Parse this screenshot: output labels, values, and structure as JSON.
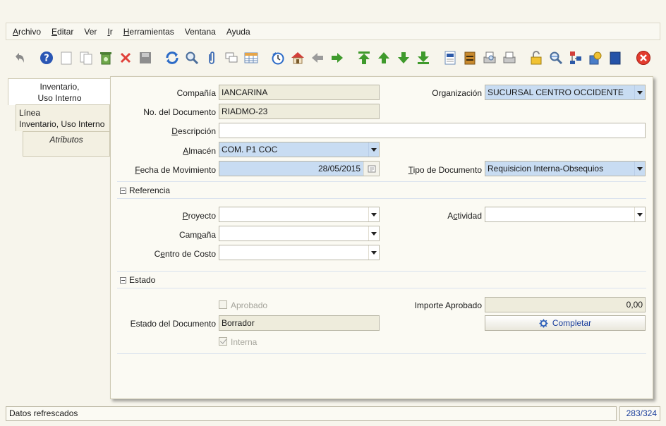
{
  "menu": {
    "archivo": {
      "first": "A",
      "rest": "rchivo"
    },
    "editar": {
      "first": "E",
      "rest": "ditar"
    },
    "ver": {
      "first": "",
      "rest": "Ver"
    },
    "ir": {
      "first": "I",
      "rest": "r"
    },
    "herramientas": {
      "first": "H",
      "rest": "erramientas"
    },
    "ventana": {
      "first": "",
      "rest": "Ventana"
    },
    "ayuda": {
      "first": "",
      "rest": "Ayuda"
    }
  },
  "tabs": {
    "t1_line1": "Inventario,",
    "t1_line2": "Uso Interno",
    "t2_line1": "Línea",
    "t2_line2": "Inventario, Uso Interno",
    "t3": "Atributos"
  },
  "form": {
    "compania_label": "Compañía",
    "compania_value": "IANCARINA",
    "organizacion_label": "Organización",
    "organizacion_value": "SUCURSAL CENTRO OCCIDENTE",
    "nodoc_label": "No. del Documento",
    "nodoc_value": "RIADMO-23",
    "descripcion_label": {
      "first": "D",
      "rest": "escripción"
    },
    "descripcion_value": "",
    "almacen_label": {
      "first": "A",
      "rest": "lmacén"
    },
    "almacen_value": "COM. P1 COC",
    "fecha_label": {
      "first": "F",
      "rest": "echa de Movimiento"
    },
    "fecha_value": "28/05/2015",
    "tipodoc_label": {
      "first": "T",
      "rest": "ipo de Documento"
    },
    "tipodoc_value": "Requisicion Interna-Obsequios"
  },
  "referencia": {
    "title": "Referencia",
    "proyecto_label": {
      "first": "P",
      "rest": "royecto"
    },
    "actividad_label": {
      "pre": "A",
      "first": "c",
      "rest": "tividad"
    },
    "campana_label": {
      "pre": "Cam",
      "first": "p",
      "rest": "aña"
    },
    "centro_label": {
      "pre": "C",
      "first": "e",
      "rest": "ntro de Costo"
    }
  },
  "estado": {
    "title": "Estado",
    "aprobado_label": "Aprobado",
    "importe_label": "Importe Aprobado",
    "importe_value": "0,00",
    "estado_doc_label": "Estado del Documento",
    "estado_doc_value": "Borrador",
    "completar_label": "Completar",
    "interna_label": "Interna"
  },
  "status": {
    "message": "Datos refrescados",
    "record": "283/324"
  },
  "colors": {
    "highlight_field": "#c8dcf2",
    "readonly_field": "#eeecdc",
    "link_blue": "#1a3e9c",
    "background": "#f7f5ec"
  },
  "icons": [
    "undo-icon",
    "help-icon",
    "new-icon",
    "copy-icon",
    "delete-record-icon",
    "delete-icon",
    "save-icon",
    "refresh-icon",
    "find-icon",
    "attachment-icon",
    "chat-icon",
    "grid-toggle-icon",
    "history-icon",
    "home-icon",
    "back-icon",
    "forward-icon",
    "first-record-icon",
    "previous-record-icon",
    "next-record-icon",
    "last-record-icon",
    "report-icon",
    "archive-icon",
    "print-preview-icon",
    "print-icon",
    "lock-icon",
    "zoom-across-icon",
    "workflow-icon",
    "product-info-icon",
    "window-icon",
    "close-icon"
  ]
}
